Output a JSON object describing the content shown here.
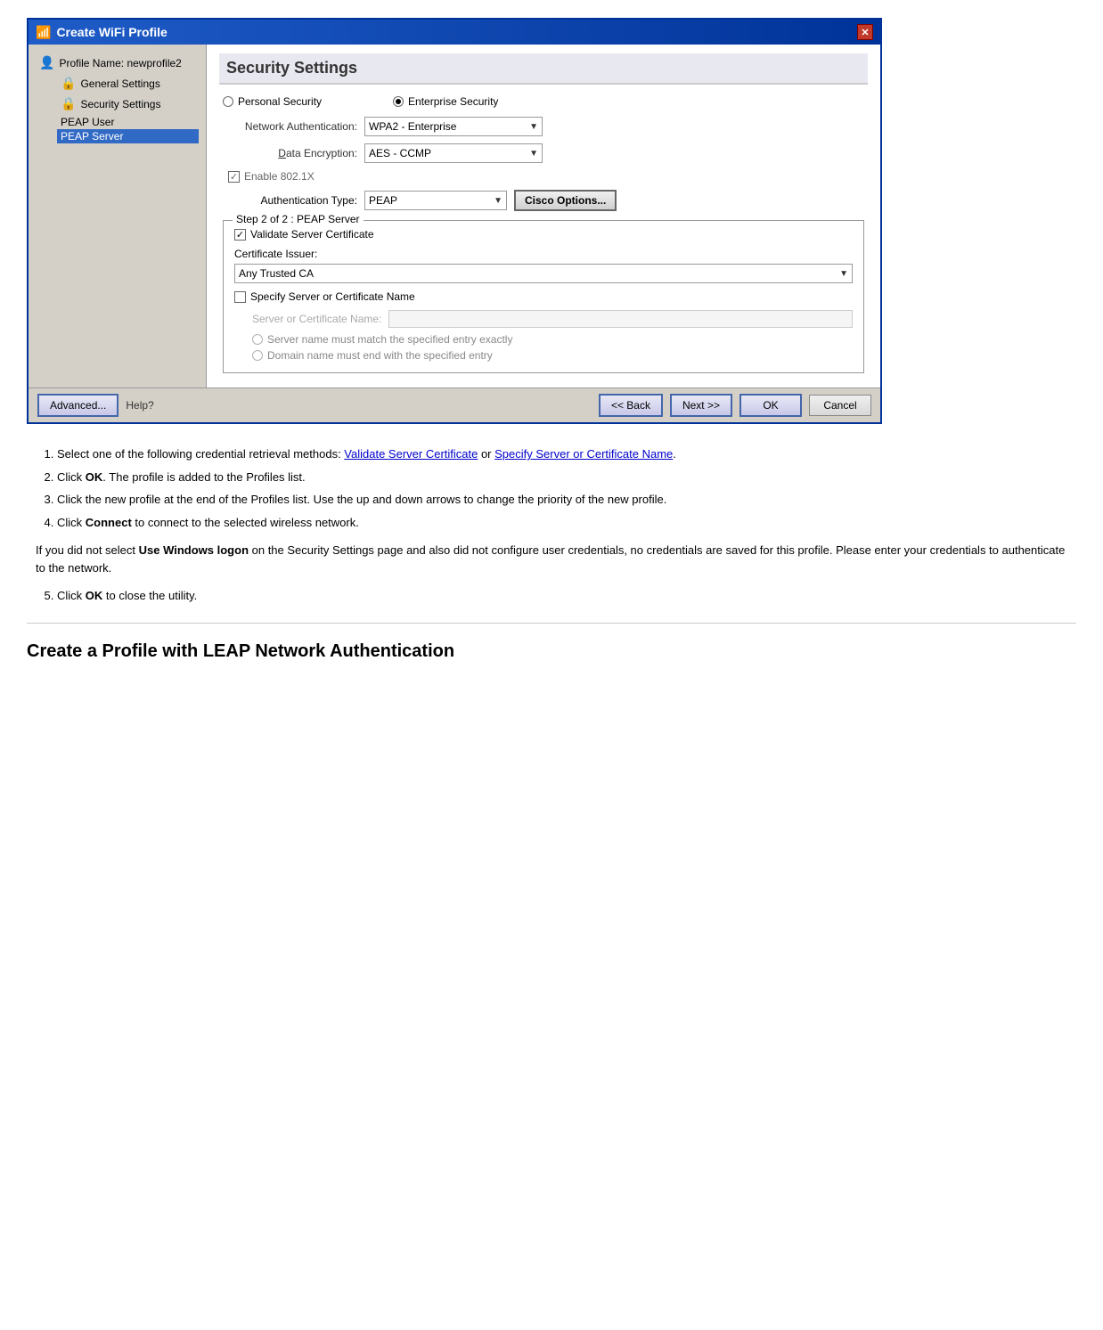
{
  "dialog": {
    "title": "Create WiFi Profile",
    "left_panel": {
      "profile_name": "Profile Name: newprofile2",
      "items": [
        {
          "label": "General Settings",
          "icon": "🔒",
          "selected": false
        },
        {
          "label": "Security Settings",
          "icon": "🔒",
          "selected": false
        },
        {
          "label": "PEAP User",
          "indent": true,
          "selected": false
        },
        {
          "label": "PEAP Server",
          "indent": true,
          "selected": true
        }
      ]
    },
    "right_panel": {
      "title": "Security Settings",
      "personal_security_label": "Personal Security",
      "enterprise_security_label": "Enterprise Security",
      "network_auth_label": "Network Authentication:",
      "network_auth_value": "WPA2 - Enterprise",
      "data_encryption_label": "Data Encryption:",
      "data_encryption_label_underline": "D",
      "data_encryption_value": "AES - CCMP",
      "enable_8021x_label": "Enable 802.1X",
      "auth_type_label": "Authentication Type:",
      "auth_type_value": "PEAP",
      "cisco_options_label": "Cisco Options...",
      "group_box_legend": "Step 2 of 2 : PEAP Server",
      "validate_cert_label": "Validate Server Certificate",
      "cert_issuer_label": "Certificate Issuer:",
      "cert_issuer_value": "Any Trusted CA",
      "specify_server_label": "Specify Server or Certificate Name",
      "server_cert_name_label": "Server or Certificate Name:",
      "server_name_match_label": "Server name must match the specified entry exactly",
      "domain_name_label": "Domain name must end with the specified entry"
    },
    "footer": {
      "advanced_label": "Advanced...",
      "help_label": "Help?",
      "back_label": "<< Back",
      "next_label": "Next >>",
      "ok_label": "OK",
      "cancel_label": "Cancel"
    }
  },
  "instructions": {
    "step1_text": "Select one of the following credential retrieval methods: ",
    "step1_link1": "Validate Server Certificate",
    "step1_or": " or ",
    "step1_link2": "Specify Server or Certificate Name",
    "step1_end": ".",
    "step2_text": "Click ",
    "step2_bold": "OK",
    "step2_rest": ". The profile is added to the Profiles list.",
    "step3_text": "Click the new profile at the end of the Profiles list. Use the up and down arrows to change the priority of the new profile.",
    "step4_text": "Click ",
    "step4_bold": "Connect",
    "step4_rest": " to connect to the selected wireless network.",
    "note_text": "If you did not select ",
    "note_bold": "Use Windows logon",
    "note_rest": " on the Security Settings page and also did not configure user credentials, no credentials are saved for this profile. Please enter your credentials to authenticate to the network.",
    "step5_text": "Click ",
    "step5_bold": "OK",
    "step5_rest": " to close the utility."
  },
  "section_title": "Create a Profile with LEAP Network Authentication"
}
